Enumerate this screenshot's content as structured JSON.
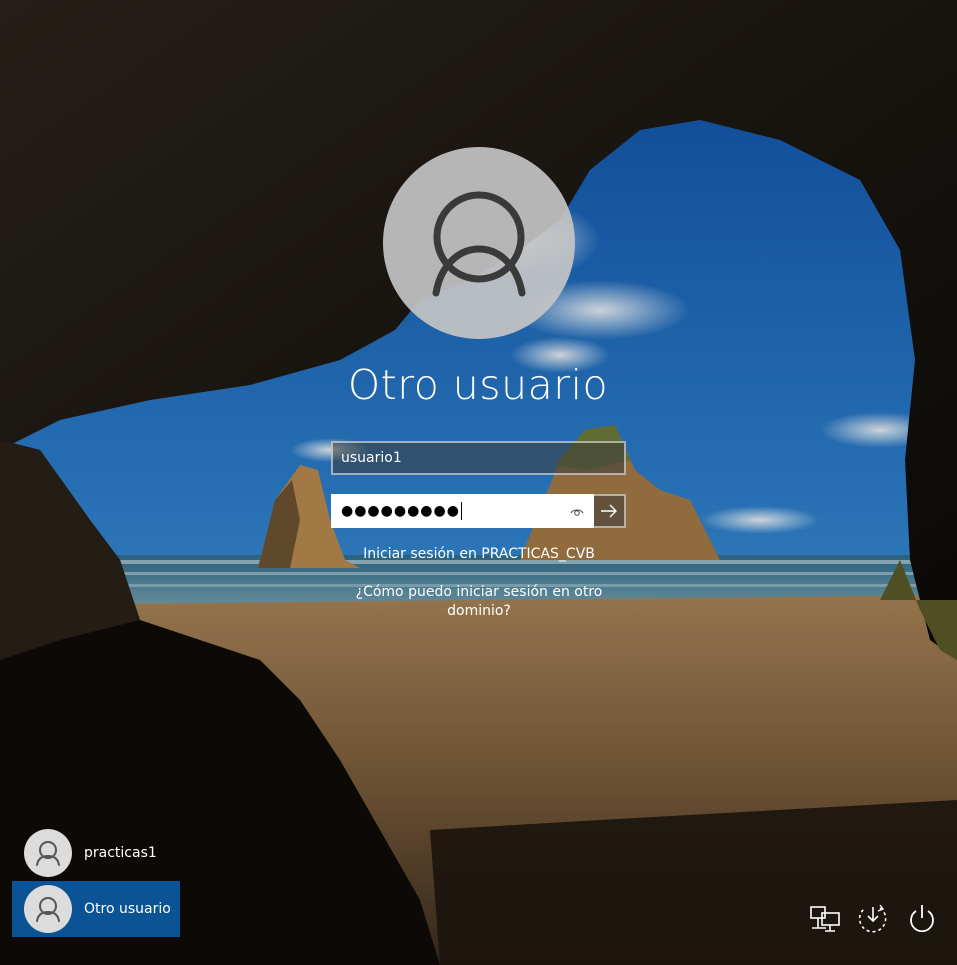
{
  "login": {
    "title": "Otro usuario",
    "username_value": "usuario1",
    "password_mask": "●●●●●●●●●",
    "domain_text": "Iniciar sesión en PRACTICAS_CVB",
    "help_link": "¿Cómo puedo iniciar sesión en otro dominio?"
  },
  "users": [
    {
      "name": "practicas1",
      "selected": false
    },
    {
      "name": "Otro usuario",
      "selected": true
    }
  ],
  "icons": {
    "avatar": "user-silhouette-icon",
    "reveal": "eye-icon",
    "submit": "arrow-right-icon",
    "network": "network-icon",
    "accessibility": "ease-of-access-icon",
    "power": "power-icon"
  },
  "colors": {
    "selected_user_bg": "#0a5394",
    "text": "#ffffff"
  }
}
